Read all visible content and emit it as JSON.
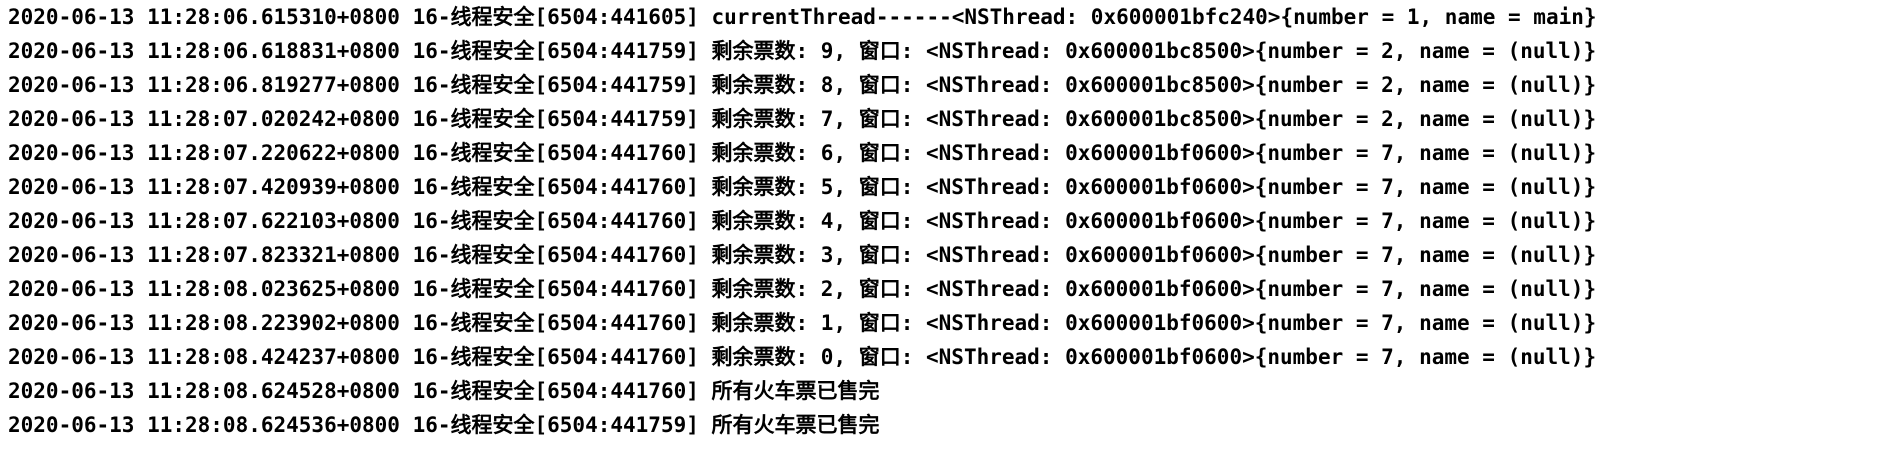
{
  "console": {
    "lines": [
      "2020-06-13 11:28:06.615310+0800 16-线程安全[6504:441605] currentThread------<NSThread: 0x600001bfc240>{number = 1, name = main}",
      "2020-06-13 11:28:06.618831+0800 16-线程安全[6504:441759] 剩余票数: 9, 窗口: <NSThread: 0x600001bc8500>{number = 2, name = (null)}",
      "2020-06-13 11:28:06.819277+0800 16-线程安全[6504:441759] 剩余票数: 8, 窗口: <NSThread: 0x600001bc8500>{number = 2, name = (null)}",
      "2020-06-13 11:28:07.020242+0800 16-线程安全[6504:441759] 剩余票数: 7, 窗口: <NSThread: 0x600001bc8500>{number = 2, name = (null)}",
      "2020-06-13 11:28:07.220622+0800 16-线程安全[6504:441760] 剩余票数: 6, 窗口: <NSThread: 0x600001bf0600>{number = 7, name = (null)}",
      "2020-06-13 11:28:07.420939+0800 16-线程安全[6504:441760] 剩余票数: 5, 窗口: <NSThread: 0x600001bf0600>{number = 7, name = (null)}",
      "2020-06-13 11:28:07.622103+0800 16-线程安全[6504:441760] 剩余票数: 4, 窗口: <NSThread: 0x600001bf0600>{number = 7, name = (null)}",
      "2020-06-13 11:28:07.823321+0800 16-线程安全[6504:441760] 剩余票数: 3, 窗口: <NSThread: 0x600001bf0600>{number = 7, name = (null)}",
      "2020-06-13 11:28:08.023625+0800 16-线程安全[6504:441760] 剩余票数: 2, 窗口: <NSThread: 0x600001bf0600>{number = 7, name = (null)}",
      "2020-06-13 11:28:08.223902+0800 16-线程安全[6504:441760] 剩余票数: 1, 窗口: <NSThread: 0x600001bf0600>{number = 7, name = (null)}",
      "2020-06-13 11:28:08.424237+0800 16-线程安全[6504:441760] 剩余票数: 0, 窗口: <NSThread: 0x600001bf0600>{number = 7, name = (null)}",
      "2020-06-13 11:28:08.624528+0800 16-线程安全[6504:441760] 所有火车票已售完",
      "2020-06-13 11:28:08.624536+0800 16-线程安全[6504:441759] 所有火车票已售完"
    ]
  }
}
